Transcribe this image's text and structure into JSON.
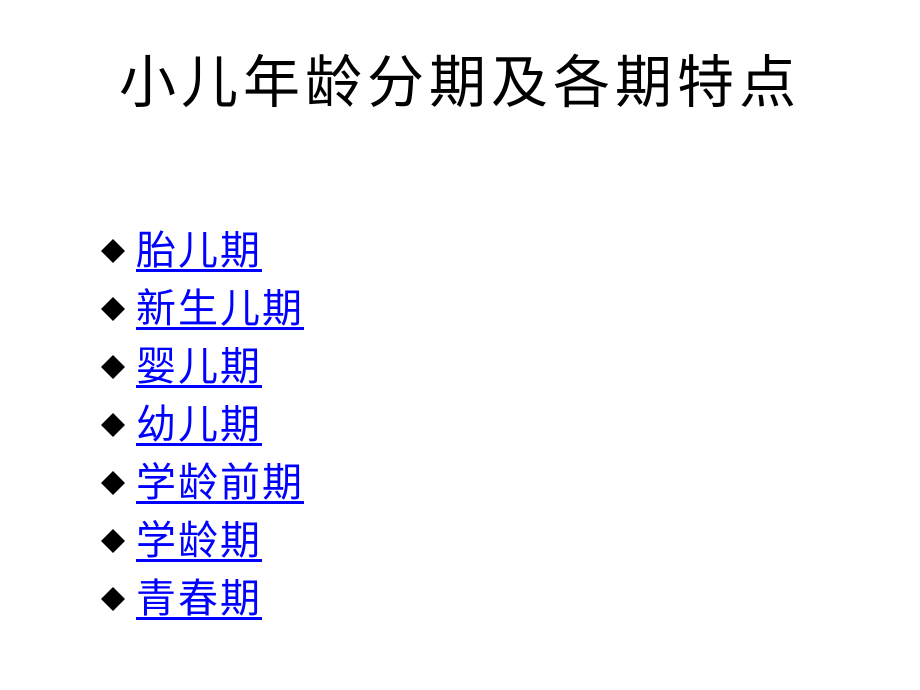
{
  "slide": {
    "background_color": "#ffffff",
    "title": "小儿年龄分期及各期特点",
    "title_color": "#000000",
    "link_color": "#0000ff",
    "bullet_color": "#000000",
    "bullet_icon": "black-diamond-bullet-icon"
  },
  "links": [
    {
      "label": "胎儿期"
    },
    {
      "label": "新生儿期"
    },
    {
      "label": "婴儿期"
    },
    {
      "label": "幼儿期"
    },
    {
      "label": "学龄前期"
    },
    {
      "label": "学龄期"
    },
    {
      "label": "青春期"
    }
  ]
}
